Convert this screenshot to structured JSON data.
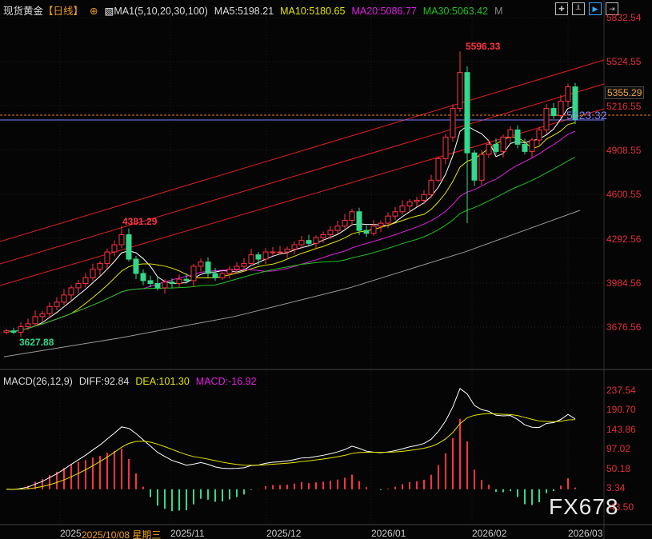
{
  "header": {
    "symbol": "现货黄金",
    "period": "【日线】",
    "ma_label": "MA1(5,10,20,30,100)",
    "ma5": "MA5:5198.21",
    "ma10": "MA10:5180.65",
    "ma20": "MA20:5086.77",
    "ma30": "MA30:5063.42",
    "more": "M"
  },
  "colors": {
    "ma5": "#ffffff",
    "ma10": "#e6e600",
    "ma20": "#e020e0",
    "ma30": "#20c020",
    "ma100": "#999999",
    "up": "#ff3344",
    "down": "#33d88a"
  },
  "price_axis": [
    "5832.54",
    "5524.55",
    "5216.55",
    "4908.55",
    "4600.55",
    "4292.56",
    "3984.56",
    "3676.56"
  ],
  "price_tags": {
    "high_box": "5355.29",
    "current": "5123.32"
  },
  "annotations": {
    "max": "5596.33",
    "peak": "4381.29",
    "min": "3627.88"
  },
  "macd": {
    "label": "MACD(26,12,9)",
    "diff": "DIFF:92.84",
    "dea": "DEA:101.30",
    "macd": "MACD:-16.92",
    "axis": [
      "237.54",
      "190.70",
      "143.86",
      "97.02",
      "50.18",
      "3.34",
      "-43.50"
    ]
  },
  "time_axis": {
    "labels": [
      "2025",
      "2025/11",
      "2025/12",
      "2026/01",
      "2026/02",
      "2026/03"
    ],
    "crosshair_date": "2025/10/08 星期三"
  },
  "watermark": "FX678",
  "toolbar": [
    "crosshair-icon",
    "chart-icon",
    "play-icon",
    "export-icon"
  ],
  "chart_data": {
    "type": "candlestick",
    "ylim": [
      3676.56,
      5832.54
    ],
    "closes": [
      3650,
      3640,
      3680,
      3700,
      3750,
      3770,
      3820,
      3850,
      3900,
      3950,
      3980,
      4020,
      4080,
      4120,
      4200,
      4250,
      4320,
      4150,
      4050,
      4000,
      3980,
      3950,
      3990,
      3980,
      4010,
      4000,
      4100,
      4130,
      4050,
      4020,
      4050,
      4080,
      4100,
      4120,
      4180,
      4150,
      4200,
      4200,
      4200,
      4220,
      4250,
      4280,
      4260,
      4300,
      4320,
      4350,
      4380,
      4420,
      4480,
      4350,
      4330,
      4380,
      4400,
      4450,
      4480,
      4520,
      4550,
      4560,
      4600,
      4700,
      4850,
      5000,
      5200,
      5450,
      4890,
      4700,
      4880,
      4950,
      4900,
      5000,
      5050,
      4950,
      4900,
      4980,
      5050,
      5200,
      5150,
      5250,
      5350,
      5123.32
    ],
    "ma100": [
      3470,
      3600,
      3750,
      3950,
      4200,
      4490
    ]
  }
}
